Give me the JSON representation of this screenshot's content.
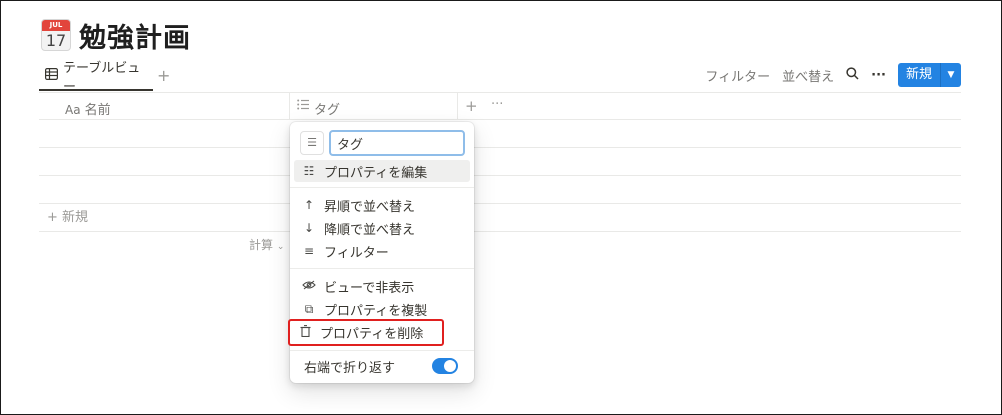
{
  "page": {
    "title": "勉強計画",
    "icon_month": "JUL",
    "icon_day": "17"
  },
  "views": {
    "active_tab": "テーブルビュー",
    "add_icon": "plus-icon"
  },
  "toolbar": {
    "filter": "フィルター",
    "sort": "並べ替え",
    "new_label": "新規",
    "accent": "#2383e2"
  },
  "table": {
    "col_name": "名前",
    "col_name_prefix": "Aa",
    "col_tag": "タグ",
    "new_row": "新規",
    "calc": "計算"
  },
  "menu": {
    "input_value": "タグ",
    "items": {
      "edit": "プロパティを編集",
      "sort_asc": "昇順で並べ替え",
      "sort_desc": "降順で並べ替え",
      "filter": "フィルター",
      "hide": "ビューで非表示",
      "duplicate": "プロパティを複製",
      "delete": "プロパティを削除",
      "wrap": "右端で折り返す"
    },
    "wrap_enabled": true,
    "highlight_color": "#e0201f"
  }
}
